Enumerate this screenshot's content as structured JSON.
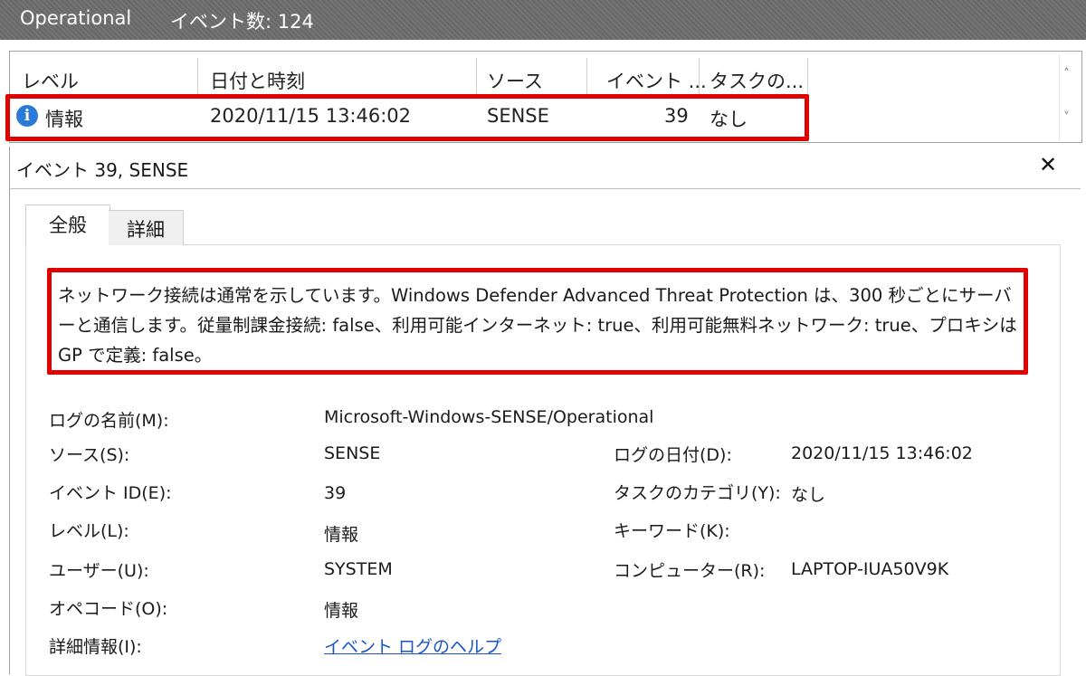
{
  "header": {
    "log_name": "Operational",
    "event_count_label": "イベント数: 124"
  },
  "event_list": {
    "columns": [
      "レベル",
      "日付と時刻",
      "ソース",
      "イベント ...",
      "タスクの..."
    ],
    "rows": [
      {
        "level": "情報",
        "datetime": "2020/11/15 13:46:02",
        "source": "SENSE",
        "event_id": "39",
        "task": "なし"
      }
    ]
  },
  "detail": {
    "title": "イベント 39, SENSE",
    "tabs": [
      "全般",
      "詳細"
    ],
    "message": "ネットワーク接続は通常を示しています。Windows Defender Advanced Threat Protection は、300 秒ごとにサーバーと通信します。従量制課金接続: false、利用可能インターネット: true、利用可能無料ネットワーク: true、プロキシは GP で定義: false。",
    "fields": {
      "log_name_label": "ログの名前(M):",
      "log_name": "Microsoft-Windows-SENSE/Operational",
      "source_label": "ソース(S):",
      "source": "SENSE",
      "logged_label": "ログの日付(D):",
      "logged": "2020/11/15 13:46:02",
      "event_id_label": "イベント ID(E):",
      "event_id": "39",
      "task_category_label": "タスクのカテゴリ(Y):",
      "task_category": "なし",
      "level_label": "レベル(L):",
      "level": "情報",
      "keywords_label": "キーワード(K):",
      "keywords": "",
      "user_label": "ユーザー(U):",
      "user": "SYSTEM",
      "computer_label": "コンピューター(R):",
      "computer": "LAPTOP-IUA50V9K",
      "opcode_label": "オペコード(O):",
      "opcode": "情報",
      "more_info_label": "詳細情報(I):",
      "more_info_link": "イベント ログのヘルプ"
    }
  },
  "colors": {
    "highlight": "#e00000",
    "link": "#1a55c8",
    "info_icon": "#2a7bd8",
    "title_band": "#6d6d6d"
  },
  "icons": {
    "level_icon": "info-icon",
    "close": "close-icon",
    "scroll_up": "chevron-up-icon",
    "scroll_down": "chevron-down-icon"
  }
}
